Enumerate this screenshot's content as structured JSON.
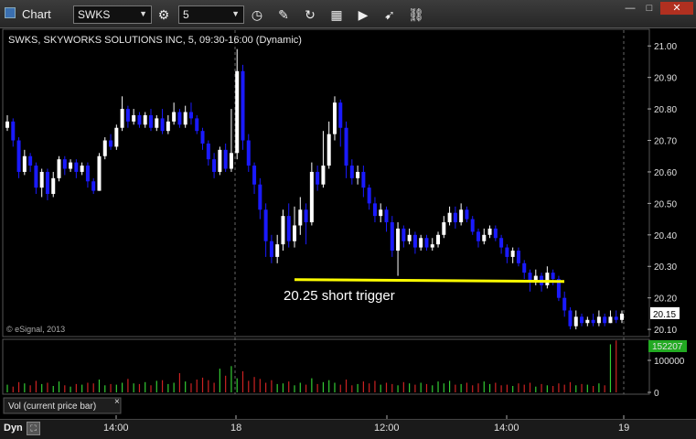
{
  "window": {
    "title": "Chart"
  },
  "toolbar": {
    "symbol": "SWKS",
    "interval": "5",
    "icons": [
      "gear-icon",
      "clock-icon",
      "pencil-icon",
      "refresh-icon",
      "calendar-icon",
      "play-icon",
      "cursor-icon",
      "link-icon"
    ]
  },
  "window_controls": {
    "minimize": "—",
    "maximize": "□",
    "close": "✕"
  },
  "chart_header": "SWKS, SKYWORKS SOLUTIONS INC, 5, 09:30-16:00 (Dynamic)",
  "watermark": "© eSignal, 2013",
  "price_tag": "20.15",
  "volume_tag": "152207",
  "volume_panel_label": "Vol (current price bar)",
  "volume_close_glyph": "×",
  "bottom_bar": {
    "mode": "Dyn"
  },
  "annotation": {
    "text": "20.25 short trigger",
    "price": 20.255,
    "line_color": "#ffff00"
  },
  "colors": {
    "up": "#ffffff",
    "down": "#1a1aff",
    "vol_up": "#33cc33",
    "vol_down": "#cc2222",
    "tag": "#22aa22"
  },
  "chart_data": {
    "type": "candlestick",
    "y_ticks": [
      "21.00",
      "20.90",
      "20.80",
      "20.70",
      "20.60",
      "20.50",
      "20.40",
      "20.30",
      "20.20",
      "20.10"
    ],
    "ylim": [
      20.08,
      21.05
    ],
    "x_ticks": [
      "14:00",
      "18",
      "12:00",
      "14:00",
      "19"
    ],
    "volume_ticks": [
      "100000",
      "0"
    ],
    "volume_max": 160000,
    "candles": [
      [
        20.74,
        20.76,
        20.78,
        20.73
      ],
      [
        20.76,
        20.7,
        20.77,
        20.68
      ],
      [
        20.7,
        20.6,
        20.71,
        20.58
      ],
      [
        20.6,
        20.65,
        20.67,
        20.59
      ],
      [
        20.65,
        20.62,
        20.66,
        20.6
      ],
      [
        20.62,
        20.55,
        20.63,
        20.53
      ],
      [
        20.55,
        20.6,
        20.61,
        20.52
      ],
      [
        20.6,
        20.53,
        20.61,
        20.51
      ],
      [
        20.53,
        20.58,
        20.6,
        20.52
      ],
      [
        20.58,
        20.64,
        20.65,
        20.57
      ],
      [
        20.64,
        20.61,
        20.65,
        20.59
      ],
      [
        20.61,
        20.63,
        20.64,
        20.6
      ],
      [
        20.63,
        20.6,
        20.64,
        20.58
      ],
      [
        20.6,
        20.62,
        20.63,
        20.59
      ],
      [
        20.62,
        20.57,
        20.63,
        20.55
      ],
      [
        20.57,
        20.54,
        20.58,
        20.53
      ],
      [
        20.54,
        20.65,
        20.66,
        20.54
      ],
      [
        20.65,
        20.7,
        20.71,
        20.64
      ],
      [
        20.7,
        20.68,
        20.72,
        20.67
      ],
      [
        20.68,
        20.74,
        20.75,
        20.67
      ],
      [
        20.74,
        20.8,
        20.84,
        20.73
      ],
      [
        20.8,
        20.76,
        20.81,
        20.74
      ],
      [
        20.76,
        20.78,
        20.8,
        20.75
      ],
      [
        20.78,
        20.75,
        20.79,
        20.74
      ],
      [
        20.75,
        20.78,
        20.79,
        20.74
      ],
      [
        20.78,
        20.74,
        20.8,
        20.73
      ],
      [
        20.74,
        20.77,
        20.78,
        20.73
      ],
      [
        20.77,
        20.73,
        20.8,
        20.72
      ],
      [
        20.73,
        20.76,
        20.78,
        20.72
      ],
      [
        20.76,
        20.79,
        20.82,
        20.75
      ],
      [
        20.79,
        20.75,
        20.8,
        20.74
      ],
      [
        20.75,
        20.79,
        20.81,
        20.74
      ],
      [
        20.79,
        20.77,
        20.82,
        20.75
      ],
      [
        20.77,
        20.73,
        20.78,
        20.72
      ],
      [
        20.73,
        20.69,
        20.74,
        20.67
      ],
      [
        20.69,
        20.64,
        20.7,
        20.62
      ],
      [
        20.64,
        20.6,
        20.66,
        20.58
      ],
      [
        20.6,
        20.67,
        20.68,
        20.59
      ],
      [
        20.67,
        20.61,
        20.69,
        20.6
      ],
      [
        20.61,
        20.66,
        20.8,
        20.6
      ],
      [
        20.66,
        20.92,
        20.99,
        20.64
      ],
      [
        20.92,
        20.7,
        20.94,
        20.67
      ],
      [
        20.7,
        20.62,
        20.72,
        20.6
      ],
      [
        20.62,
        20.56,
        20.63,
        20.53
      ],
      [
        20.56,
        20.48,
        20.58,
        20.45
      ],
      [
        20.48,
        20.38,
        20.5,
        20.33
      ],
      [
        20.38,
        20.33,
        20.4,
        20.31
      ],
      [
        20.33,
        20.37,
        20.4,
        20.31
      ],
      [
        20.37,
        20.46,
        20.48,
        20.35
      ],
      [
        20.46,
        20.38,
        20.5,
        20.36
      ],
      [
        20.38,
        20.43,
        20.49,
        20.36
      ],
      [
        20.43,
        20.48,
        20.52,
        20.4
      ],
      [
        20.48,
        20.44,
        20.5,
        20.37
      ],
      [
        20.44,
        20.6,
        20.63,
        20.43
      ],
      [
        20.6,
        20.56,
        20.62,
        20.54
      ],
      [
        20.56,
        20.62,
        20.73,
        20.55
      ],
      [
        20.62,
        20.72,
        20.76,
        20.61
      ],
      [
        20.72,
        20.82,
        20.84,
        20.7
      ],
      [
        20.82,
        20.74,
        20.83,
        20.68
      ],
      [
        20.74,
        20.62,
        20.76,
        20.58
      ],
      [
        20.62,
        20.58,
        20.64,
        20.56
      ],
      [
        20.58,
        20.6,
        20.62,
        20.56
      ],
      [
        20.6,
        20.55,
        20.62,
        20.52
      ],
      [
        20.55,
        20.5,
        20.56,
        20.48
      ],
      [
        20.5,
        20.46,
        20.52,
        20.44
      ],
      [
        20.46,
        20.48,
        20.5,
        20.44
      ],
      [
        20.48,
        20.44,
        20.49,
        20.41
      ],
      [
        20.44,
        20.35,
        20.46,
        20.33
      ],
      [
        20.35,
        20.42,
        20.44,
        20.27
      ],
      [
        20.42,
        20.38,
        20.43,
        20.36
      ],
      [
        20.38,
        20.4,
        20.42,
        20.37
      ],
      [
        20.4,
        20.36,
        20.41,
        20.34
      ],
      [
        20.36,
        20.39,
        20.4,
        20.35
      ],
      [
        20.39,
        20.36,
        20.4,
        20.35
      ],
      [
        20.36,
        20.37,
        20.39,
        20.35
      ],
      [
        20.37,
        20.4,
        20.41,
        20.36
      ],
      [
        20.4,
        20.44,
        20.46,
        20.39
      ],
      [
        20.44,
        20.47,
        20.49,
        20.43
      ],
      [
        20.47,
        20.44,
        20.49,
        20.42
      ],
      [
        20.44,
        20.48,
        20.5,
        20.43
      ],
      [
        20.48,
        20.45,
        20.49,
        20.44
      ],
      [
        20.45,
        20.41,
        20.46,
        20.4
      ],
      [
        20.41,
        20.38,
        20.42,
        20.36
      ],
      [
        20.38,
        20.4,
        20.42,
        20.37
      ],
      [
        20.4,
        20.42,
        20.43,
        20.39
      ],
      [
        20.42,
        20.39,
        20.43,
        20.38
      ],
      [
        20.39,
        20.36,
        20.4,
        20.34
      ],
      [
        20.36,
        20.33,
        20.37,
        20.31
      ],
      [
        20.33,
        20.35,
        20.36,
        20.31
      ],
      [
        20.35,
        20.31,
        20.36,
        20.3
      ],
      [
        20.31,
        20.28,
        20.32,
        20.26
      ],
      [
        20.28,
        20.25,
        20.29,
        20.22
      ],
      [
        20.25,
        20.27,
        20.29,
        20.24
      ],
      [
        20.27,
        20.24,
        20.28,
        20.22
      ],
      [
        20.24,
        20.28,
        20.3,
        20.23
      ],
      [
        20.28,
        20.26,
        20.29,
        20.24
      ],
      [
        20.26,
        20.2,
        20.27,
        20.19
      ],
      [
        20.2,
        20.16,
        20.22,
        20.14
      ],
      [
        20.16,
        20.11,
        20.17,
        20.1
      ],
      [
        20.11,
        20.14,
        20.16,
        20.1
      ],
      [
        20.14,
        20.12,
        20.15,
        20.11
      ],
      [
        20.12,
        20.13,
        20.14,
        20.11
      ],
      [
        20.13,
        20.12,
        20.15,
        20.11
      ],
      [
        20.12,
        20.14,
        20.16,
        20.11
      ],
      [
        20.14,
        20.12,
        20.15,
        20.11
      ],
      [
        20.12,
        20.14,
        20.16,
        20.12
      ],
      [
        20.14,
        20.13,
        20.16,
        20.12
      ],
      [
        20.13,
        20.15,
        20.16,
        20.12
      ]
    ],
    "volumes": [
      24,
      18,
      32,
      28,
      22,
      36,
      26,
      30,
      20,
      34,
      22,
      18,
      26,
      24,
      30,
      28,
      40,
      22,
      26,
      24,
      30,
      42,
      28,
      26,
      32,
      22,
      36,
      38,
      26,
      30,
      60,
      34,
      28,
      40,
      46,
      38,
      30,
      74,
      52,
      82,
      44,
      66,
      36,
      48,
      42,
      30,
      38,
      26,
      28,
      34,
      22,
      30,
      24,
      44,
      26,
      32,
      38,
      30,
      24,
      40,
      22,
      26,
      34,
      28,
      36,
      24,
      30,
      26,
      22,
      32,
      28,
      24,
      30,
      26,
      22,
      34,
      28,
      36,
      24,
      26,
      30,
      22,
      28,
      34,
      26,
      30,
      22,
      24,
      20,
      28,
      24,
      30,
      18,
      26,
      22,
      20,
      28,
      24,
      32,
      22,
      26,
      24,
      20,
      28,
      22,
      150,
      162
    ]
  }
}
